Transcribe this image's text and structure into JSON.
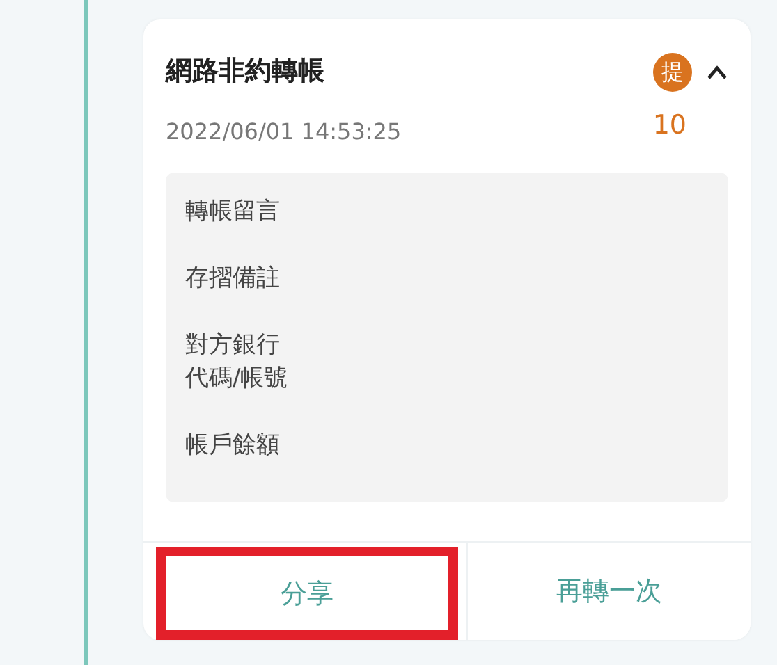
{
  "transaction": {
    "title": "網路非約轉帳",
    "datetime": "2022/06/01 14:53:25",
    "badge": "提",
    "amount": "10",
    "expanded": true,
    "details": [
      {
        "label": "轉帳留言"
      },
      {
        "label": "存摺備註"
      },
      {
        "lines": [
          "對方銀行",
          "代碼/帳號"
        ]
      },
      {
        "label": "帳戶餘額"
      }
    ],
    "actions": [
      {
        "label": "分享",
        "highlighted": true
      },
      {
        "label": "再轉一次",
        "highlighted": false
      }
    ]
  }
}
